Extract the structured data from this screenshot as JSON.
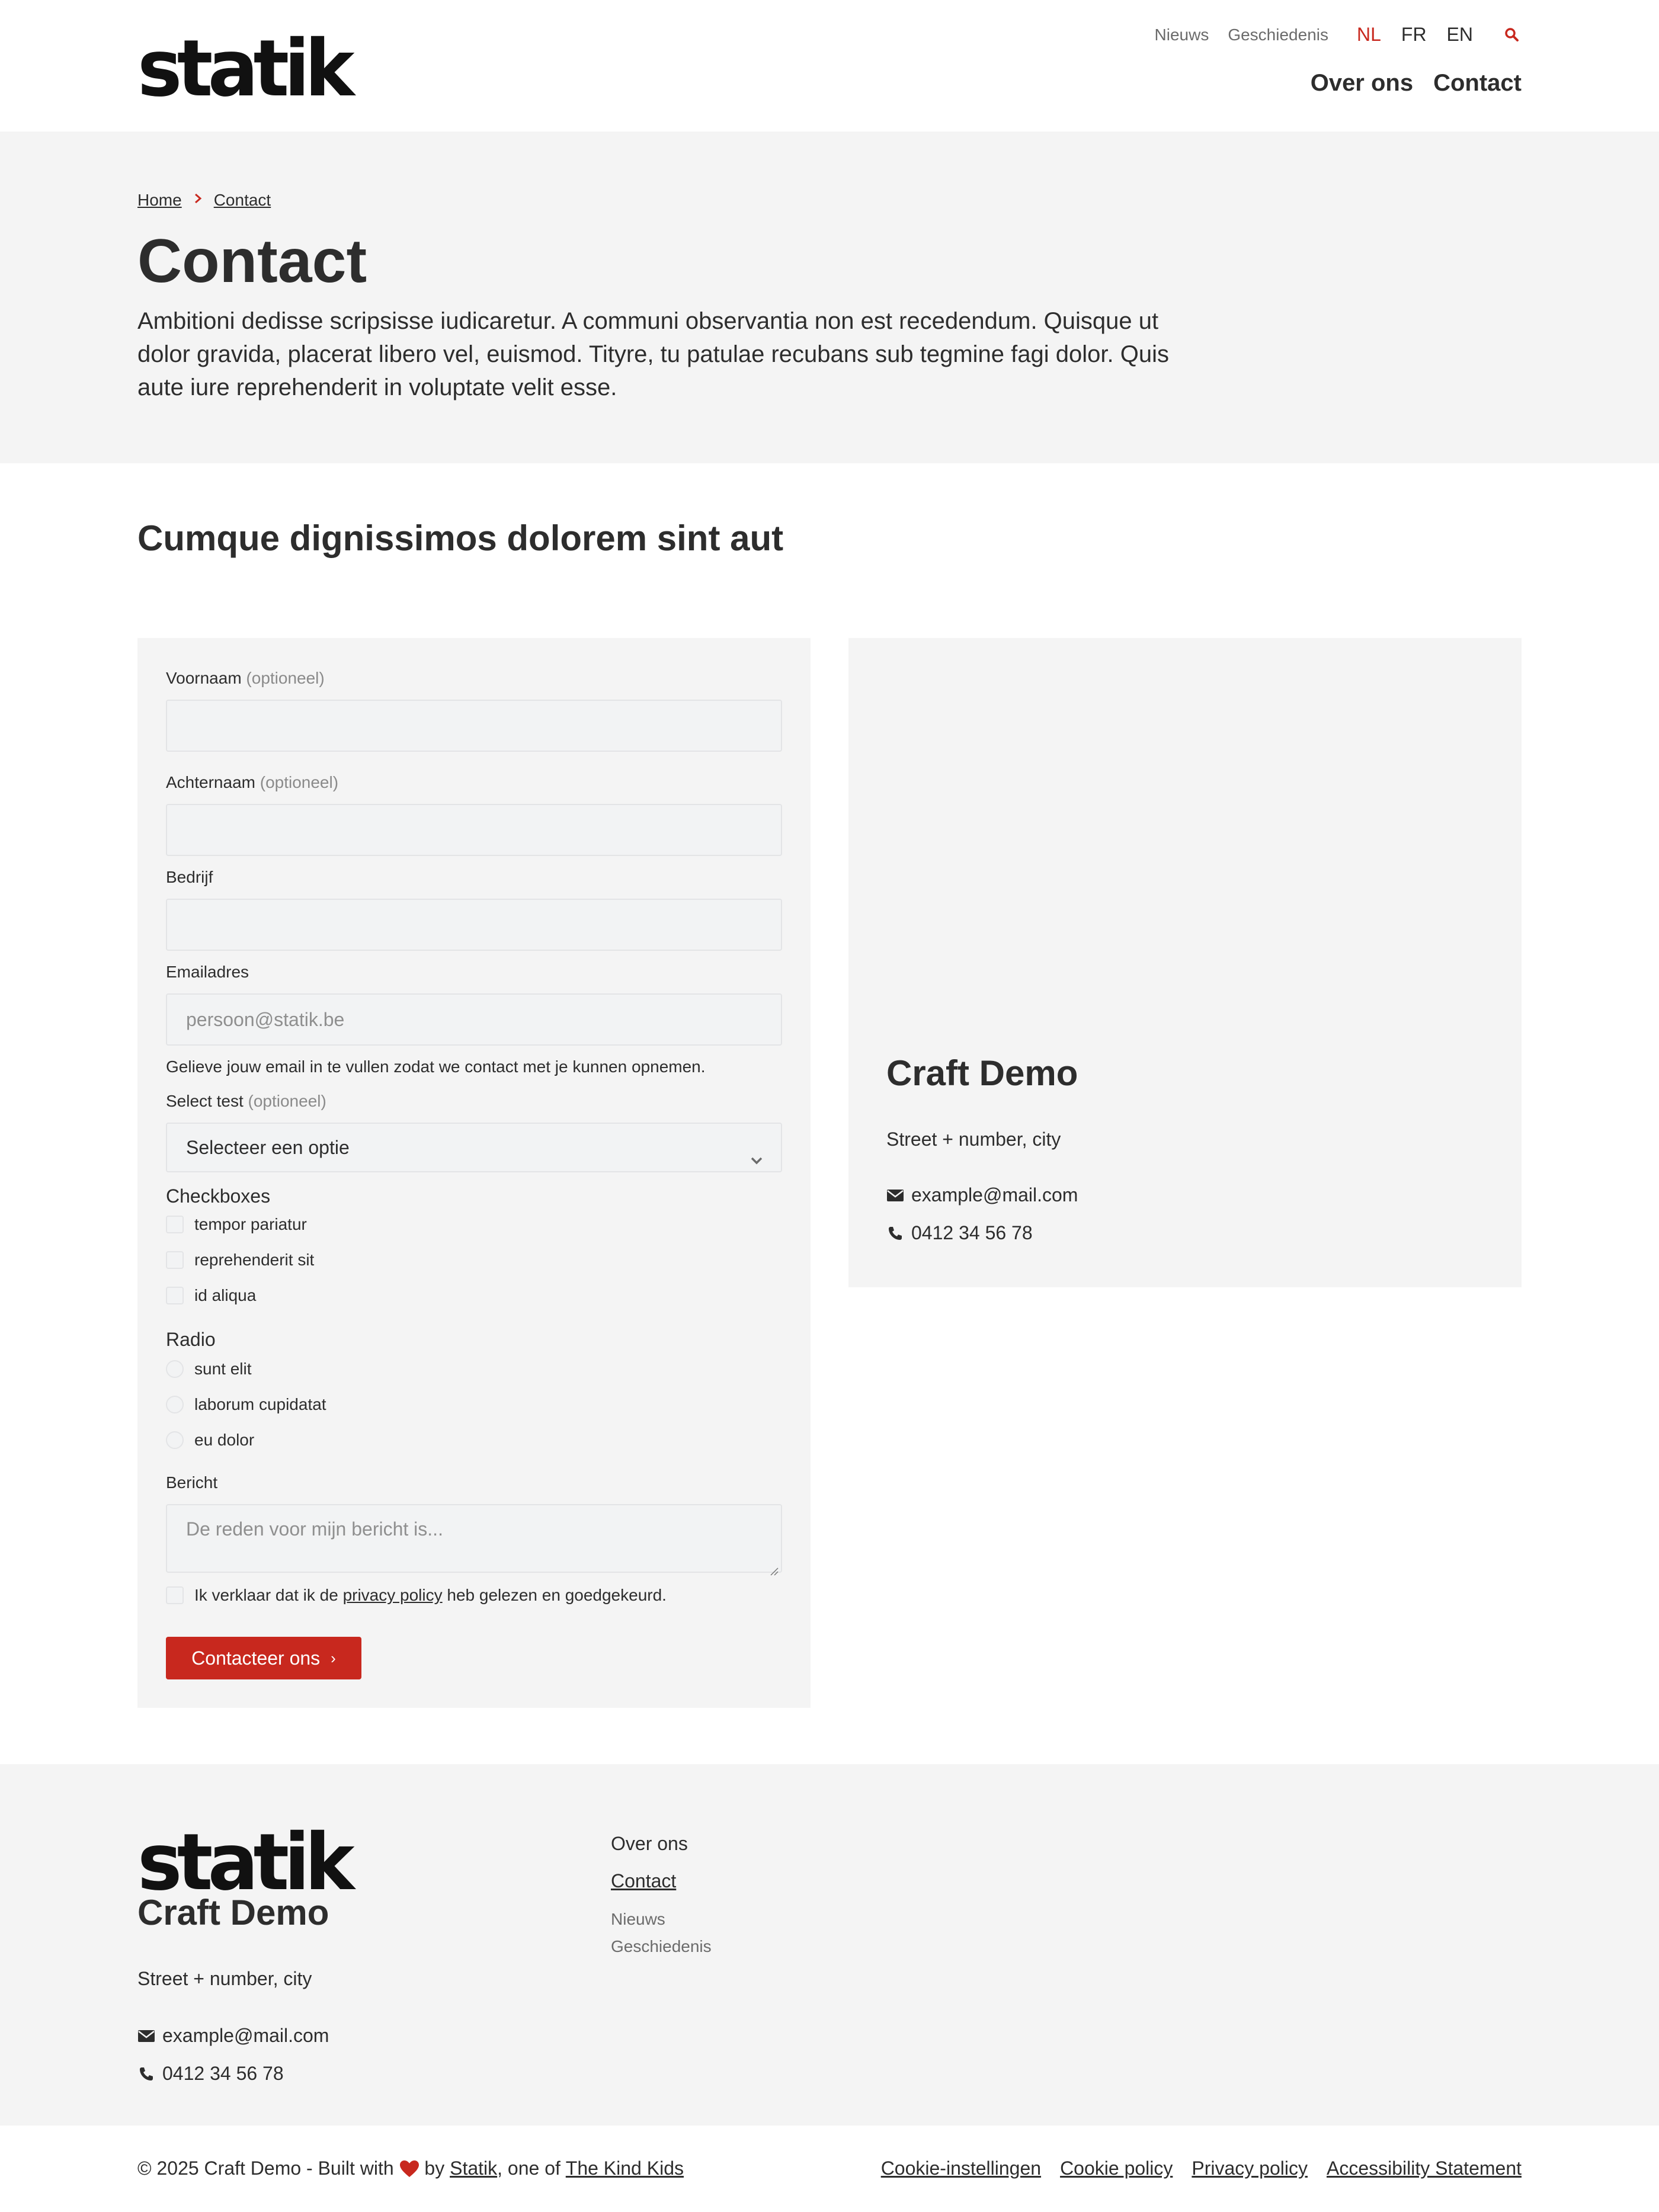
{
  "header": {
    "logo": "statik",
    "meta_nav": [
      "Nieuws",
      "Geschiedenis"
    ],
    "languages": [
      "NL",
      "FR",
      "EN"
    ],
    "active_language": "NL",
    "main_nav": [
      "Over ons",
      "Contact"
    ]
  },
  "breadcrumb": [
    "Home",
    "Contact"
  ],
  "hero": {
    "title": "Contact",
    "intro": "Ambitioni dedisse scripsisse iudicaretur. A communi observantia non est recedendum. Quisque ut dolor gravida, placerat libero vel, euismod. Tityre, tu patulae recubans sub tegmine fagi dolor. Quis aute iure reprehenderit in voluptate velit esse."
  },
  "section_title": "Cumque dignissimos dolorem sint aut",
  "form": {
    "optional": "(optioneel)",
    "first_name_label": "Voornaam",
    "last_name_label": "Achternaam",
    "company_label": "Bedrijf",
    "email_label": "Emailadres",
    "email_placeholder": "persoon@statik.be",
    "email_help": "Gelieve jouw email in te vullen zodat we contact met je kunnen opnemen.",
    "select_label": "Select test",
    "select_value": "Selecteer een optie",
    "checkboxes_title": "Checkboxes",
    "checkboxes": [
      "tempor pariatur",
      "reprehenderit sit",
      "id aliqua"
    ],
    "radio_title": "Radio",
    "radios": [
      "sunt elit",
      "laborum cupidatat",
      "eu dolor"
    ],
    "message_label": "Bericht",
    "message_placeholder": "De reden voor mijn bericht is...",
    "consent_before": "Ik verklaar dat ik de",
    "consent_link": "privacy policy",
    "consent_after": "heb gelezen en goedgekeurd.",
    "submit": "Contacteer ons",
    "submit_arrow": "›"
  },
  "info": {
    "name": "Craft Demo",
    "address": "Street + number, city",
    "email": "example@mail.com",
    "phone": "0412 34 56 78"
  },
  "footer": {
    "logo": "statik",
    "name": "Craft Demo",
    "address": "Street + number, city",
    "email": "example@mail.com",
    "phone": "0412 34 56 78",
    "nav_main": [
      "Over ons",
      "Contact"
    ],
    "nav_sub": [
      "Nieuws",
      "Geschiedenis"
    ],
    "copyright_prefix": "© 2025 Craft Demo - Built with",
    "copyright_by": "by",
    "copyright_statik": "Statik",
    "copyright_mid": ", one of",
    "copyright_kind": "The Kind Kids",
    "legal": [
      "Cookie-instellingen",
      "Cookie policy",
      "Privacy policy",
      "Accessibility Statement"
    ]
  },
  "colors": {
    "accent": "#c8281e",
    "text": "#2d2d2d",
    "panel": "#f4f4f4"
  }
}
